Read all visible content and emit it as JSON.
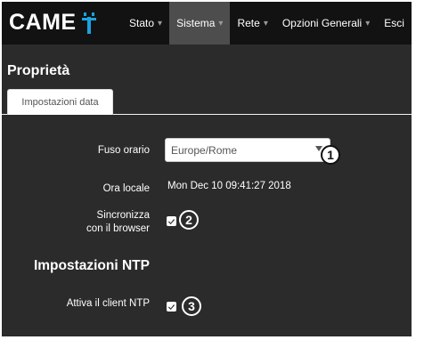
{
  "brand": {
    "logo_text": "CAME"
  },
  "nav": {
    "items": [
      {
        "label": "Stato",
        "caret": "▾",
        "active": false
      },
      {
        "label": "Sistema",
        "caret": "▾",
        "active": true
      },
      {
        "label": "Rete",
        "caret": "▾",
        "active": false
      },
      {
        "label": "Opzioni Generali",
        "caret": "▾",
        "active": false
      },
      {
        "label": "Esci"
      }
    ]
  },
  "page": {
    "title": "Proprietà",
    "tabs": [
      {
        "label": "Impostazioni data"
      }
    ]
  },
  "form": {
    "timezone": {
      "label": "Fuso orario",
      "value": "Europe/Rome",
      "callout": "1"
    },
    "local_time": {
      "label": "Ora locale",
      "value": "Mon Dec 10 09:41:27 2018"
    },
    "browser_sync": {
      "label_line1": "Sincronizza",
      "label_line2": "con il browser",
      "checked": true,
      "callout": "2"
    },
    "ntp_section": {
      "title": "Impostazioni NTP"
    },
    "ntp_client": {
      "label": "Attiva il client NTP",
      "checked": true,
      "callout": "3"
    }
  },
  "colors": {
    "background": "#2b2b2b",
    "navbar": "#121212",
    "nav_active": "#4d4d4d",
    "logo_accent": "#1aa3e0"
  }
}
